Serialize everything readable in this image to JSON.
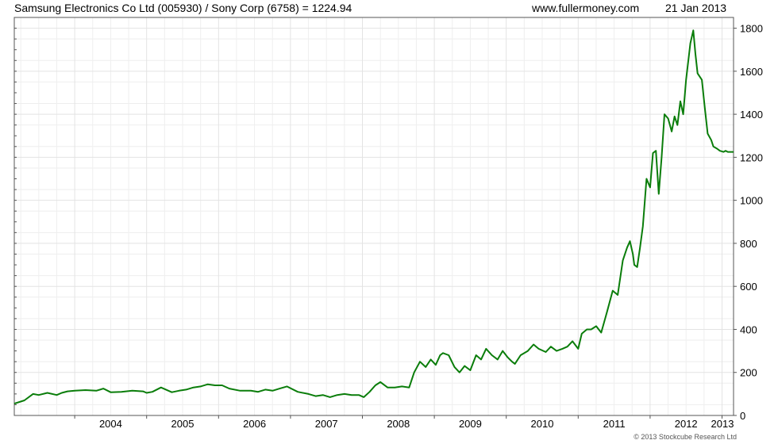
{
  "header": {
    "title": "Samsung Electronics Co Ltd (005930) / Sony Corp (6758) = 1224.94",
    "site": "www.fullermoney.com",
    "date": "21 Jan 2013"
  },
  "footer": {
    "copyright": "© 2013 Stockcube Research Ltd"
  },
  "colors": {
    "line": "#0a7d0a",
    "grid": "#e3e3e3",
    "frame": "#555555",
    "background": "#ffffff"
  },
  "chart_data": {
    "type": "line",
    "title": "Samsung Electronics Co Ltd (005930) / Sony Corp (6758) = 1224.94",
    "xlabel": "",
    "ylabel": "",
    "xlim": [
      2003.16,
      2013.16
    ],
    "ylim": [
      0,
      1850
    ],
    "y_axis_side": "right",
    "grid": true,
    "x_ticks": [
      "2004",
      "2005",
      "2006",
      "2007",
      "2008",
      "2009",
      "2010",
      "2011",
      "2012",
      "2013"
    ],
    "y_ticks": [
      0,
      200,
      400,
      600,
      800,
      1000,
      1200,
      1400,
      1600,
      1800
    ],
    "series": [
      {
        "x": [
          2003.16,
          2003.3,
          2003.42,
          2003.5,
          2003.62,
          2003.75,
          2003.82,
          2003.9,
          2004.0,
          2004.15,
          2004.3,
          2004.4,
          2004.5,
          2004.65,
          2004.8,
          2004.95,
          2005.0,
          2005.08,
          2005.2,
          2005.35,
          2005.45,
          2005.55,
          2005.65,
          2005.75,
          2005.85,
          2005.95,
          2006.05,
          2006.15,
          2006.3,
          2006.45,
          2006.55,
          2006.65,
          2006.75,
          2006.85,
          2006.95,
          2007.1,
          2007.25,
          2007.35,
          2007.45,
          2007.55,
          2007.65,
          2007.75,
          2007.85,
          2007.95,
          2008.02,
          2008.1,
          2008.18,
          2008.25,
          2008.35,
          2008.45,
          2008.55,
          2008.65,
          2008.72,
          2008.8,
          2008.88,
          2008.95,
          2009.02,
          2009.08,
          2009.12,
          2009.2,
          2009.28,
          2009.35,
          2009.42,
          2009.5,
          2009.58,
          2009.65,
          2009.72,
          2009.8,
          2009.88,
          2009.95,
          2010.02,
          2010.08,
          2010.12,
          2010.2,
          2010.3,
          2010.38,
          2010.45,
          2010.55,
          2010.62,
          2010.7,
          2010.78,
          2010.85,
          2010.92,
          2011.0,
          2011.05,
          2011.12,
          2011.18,
          2011.25,
          2011.32,
          2011.4,
          2011.48,
          2011.55,
          2011.62,
          2011.68,
          2011.72,
          2011.76,
          2011.78,
          2011.82,
          2011.86,
          2011.9,
          2011.95,
          2012.0,
          2012.04,
          2012.08,
          2012.12,
          2012.16,
          2012.2,
          2012.25,
          2012.3,
          2012.34,
          2012.38,
          2012.42,
          2012.46,
          2012.5,
          2012.56,
          2012.6,
          2012.63,
          2012.66,
          2012.72,
          2012.76,
          2012.8,
          2012.85,
          2012.88,
          2012.93,
          2012.97,
          2013.02,
          2013.05,
          2013.08,
          2013.1,
          2013.12,
          2013.14,
          2013.16
        ],
        "y": [
          55,
          70,
          100,
          95,
          105,
          95,
          105,
          112,
          115,
          118,
          115,
          125,
          108,
          110,
          115,
          112,
          105,
          110,
          130,
          108,
          115,
          120,
          130,
          135,
          145,
          140,
          140,
          125,
          115,
          115,
          110,
          120,
          115,
          125,
          135,
          110,
          100,
          90,
          95,
          85,
          95,
          100,
          95,
          95,
          85,
          110,
          140,
          155,
          130,
          130,
          135,
          130,
          200,
          250,
          225,
          260,
          235,
          280,
          290,
          280,
          225,
          200,
          230,
          210,
          280,
          260,
          310,
          280,
          260,
          300,
          270,
          250,
          240,
          280,
          300,
          330,
          310,
          295,
          320,
          300,
          310,
          320,
          345,
          310,
          380,
          400,
          400,
          415,
          385,
          480,
          580,
          560,
          720,
          780,
          810,
          750,
          700,
          690,
          780,
          880,
          1100,
          1060,
          1220,
          1230,
          1030,
          1200,
          1400,
          1380,
          1320,
          1390,
          1350,
          1460,
          1400,
          1560,
          1730,
          1790,
          1680,
          1590,
          1560,
          1430,
          1310,
          1280,
          1250,
          1240,
          1230,
          1224.94,
          1230,
          1225,
          1224.94,
          1224.94,
          1224.94,
          1224.94
        ]
      }
    ]
  }
}
